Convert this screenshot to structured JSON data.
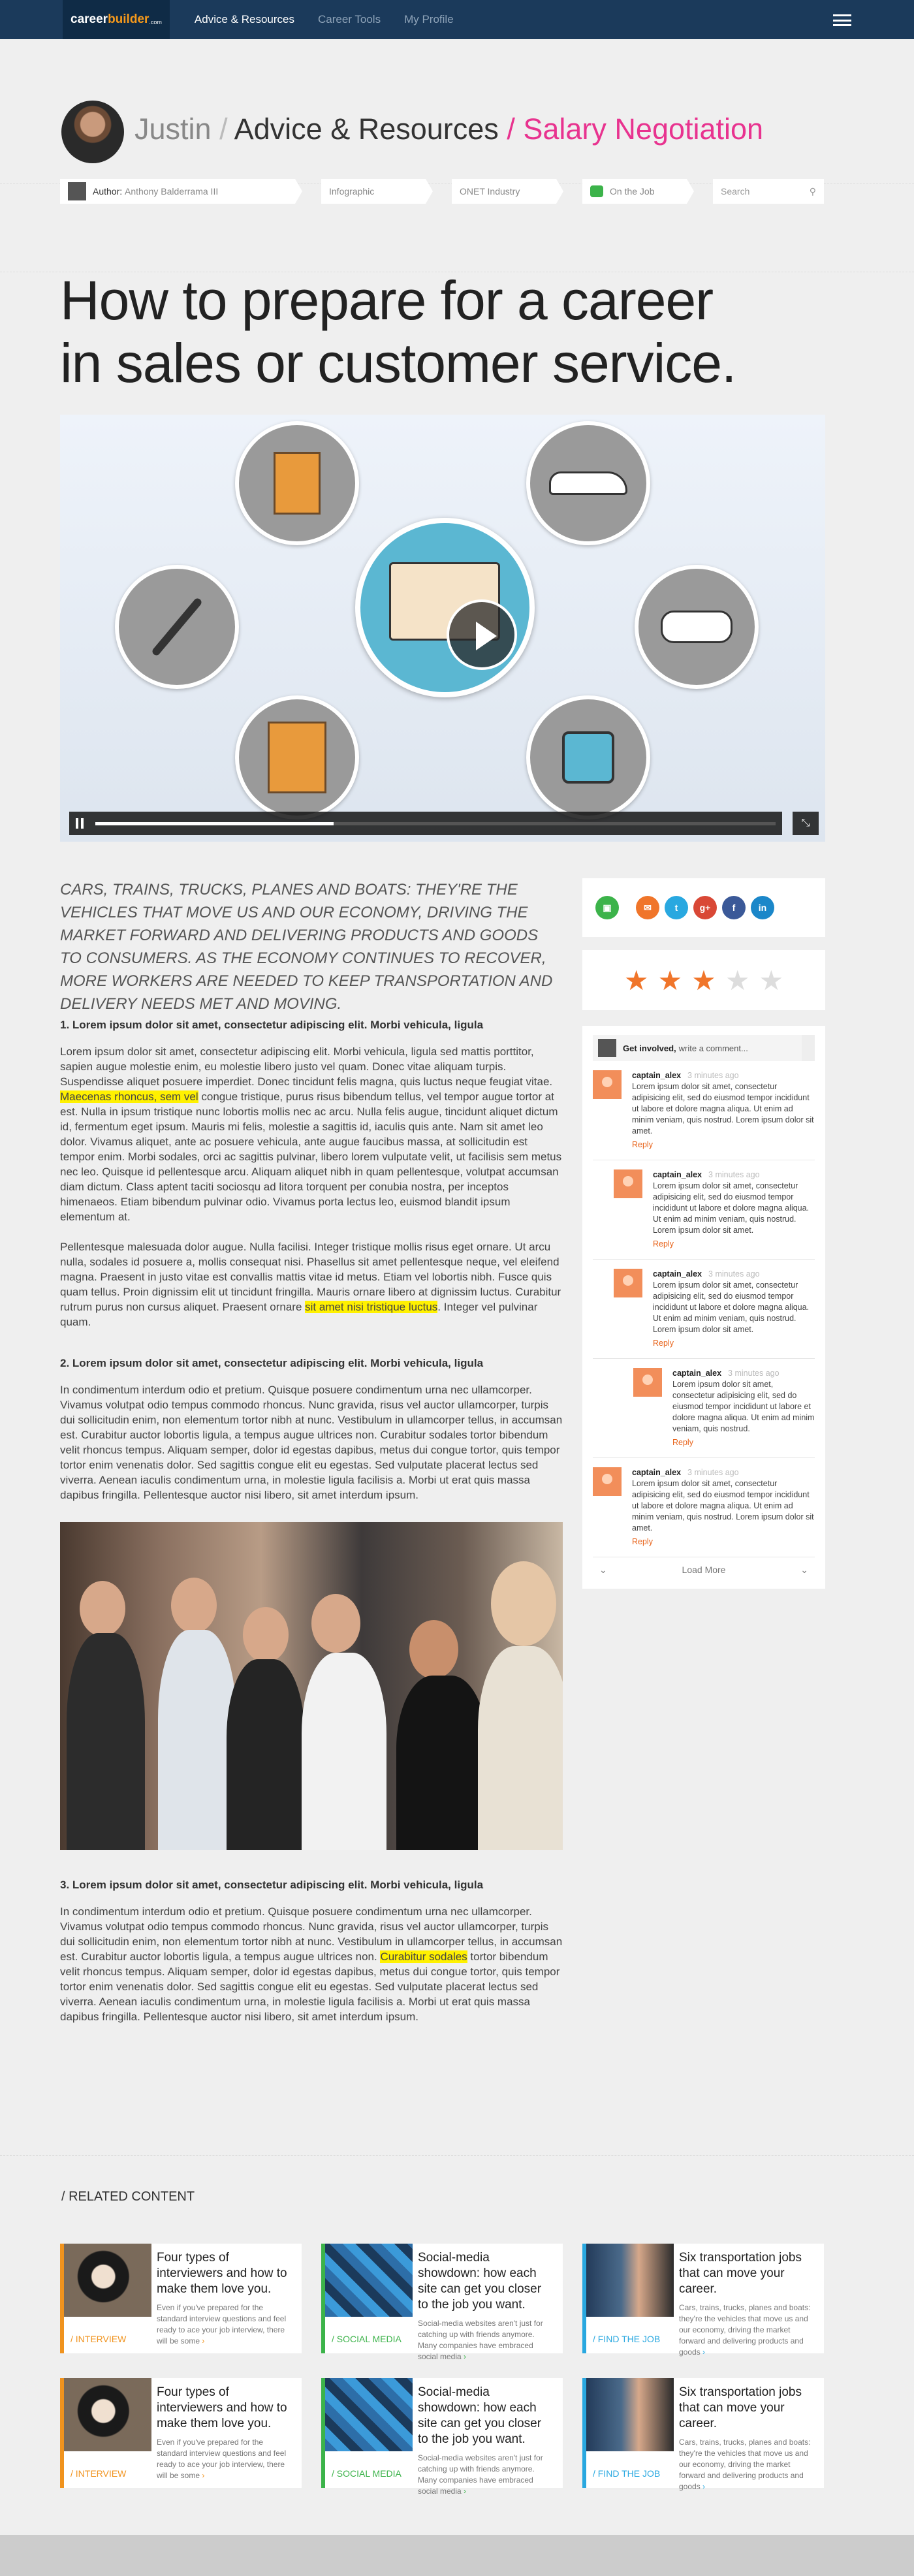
{
  "nav": {
    "logo_a": "career",
    "logo_b": "builder",
    "logo_c": ".com",
    "links": [
      "Advice & Resources",
      "Career Tools",
      "My Profile"
    ]
  },
  "breadcrumb": {
    "user": "Justin",
    "sep": "/",
    "section": "Advice & Resources",
    "topic": "Salary Negotiation"
  },
  "tags": {
    "author_label": "Author:",
    "author_name": "Anthony Balderrama III",
    "type": "Infographic",
    "industry": "ONET Industry",
    "location": "On the Job",
    "search_placeholder": "Search"
  },
  "article": {
    "title_line1": "How to prepare for a career",
    "title_line2": "in sales or customer service.",
    "intro": "Cars, trains, trucks, planes and boats: they're the vehicles that move us and our economy, driving the market forward and delivering products and goods to consumers. As the economy continues to recover, more workers are needed to keep transportation and delivery needs met and moving.",
    "s1_heading": "1. Lorem ipsum dolor sit amet, consectetur adipiscing elit. Morbi vehicula, ligula",
    "s1_p1_a": "Lorem ipsum dolor sit amet, consectetur adipiscing elit. Morbi vehicula, ligula sed mattis porttitor, sapien augue molestie enim, eu molestie libero justo vel quam. Donec vitae aliquam turpis. Suspendisse aliquet posuere imperdiet. Donec tincidunt felis magna, quis luctus neque feugiat vitae. ",
    "s1_p1_hl": "Maecenas rhoncus, sem vel",
    "s1_p1_b": " congue tristique, purus risus bibendum tellus, vel tempor augue tortor at est. Nulla in ipsum tristique nunc lobortis mollis nec ac arcu. Nulla felis augue, tincidunt aliquet dictum id, fermentum eget ipsum. Mauris mi felis, molestie a sagittis id, iaculis quis ante. Nam sit amet leo dolor. Vivamus aliquet, ante ac posuere vehicula, ante augue faucibus massa, at sollicitudin est tempor enim. Morbi sodales, orci ac sagittis pulvinar, libero lorem vulputate velit, ut facilisis sem metus nec leo. Quisque id pellentesque arcu. Aliquam aliquet nibh in quam pellentesque, volutpat accumsan diam dictum. Class aptent taciti sociosqu ad litora torquent per conubia nostra, per inceptos himenaeos. Etiam bibendum pulvinar odio. Vivamus porta lectus leo, euismod blandit ipsum elementum at.",
    "s1_p2_a": "Pellentesque malesuada dolor augue. Nulla facilisi. Integer tristique mollis risus eget ornare. Ut arcu nulla, sodales id posuere a, mollis consequat nisi. Phasellus sit amet pellentesque neque, vel eleifend magna. Praesent in justo vitae est convallis mattis vitae id metus. Etiam vel lobortis nibh. Fusce quis quam tellus. Proin dignissim elit ut tincidunt fringilla. Mauris ornare libero at dignissim luctus. Curabitur rutrum purus non cursus aliquet. Praesent ornare ",
    "s1_p2_hl": "sit amet nisi tristique luctus",
    "s1_p2_b": ". Integer vel pulvinar quam.",
    "s2_heading": "2. Lorem ipsum dolor sit amet, consectetur adipiscing elit. Morbi vehicula, ligula",
    "s2_p1": "In condimentum interdum odio et pretium. Quisque posuere condimentum urna nec ullamcorper. Vivamus volutpat odio tempus commodo rhoncus. Nunc gravida, risus vel auctor ullamcorper, turpis dui sollicitudin enim, non elementum tortor nibh at nunc. Vestibulum in ullamcorper tellus, in accumsan est. Curabitur auctor lobortis ligula, a tempus augue ultrices non. Curabitur sodales tortor bibendum velit rhoncus tempus. Aliquam semper, dolor id egestas dapibus, metus dui congue tortor, quis tempor tortor enim venenatis dolor. Sed sagittis congue elit eu egestas. Sed vulputate placerat lectus sed viverra. Aenean iaculis condimentum urna, in molestie ligula facilisis a. Morbi ut erat quis massa dapibus fringilla. Pellentesque auctor nisi libero, sit amet interdum ipsum.",
    "s3_heading": "3. Lorem ipsum dolor sit amet, consectetur adipiscing elit. Morbi vehicula, ligula",
    "s3_p1_a": "In condimentum interdum odio et pretium. Quisque posuere condimentum urna nec ullamcorper. Vivamus volutpat odio tempus commodo rhoncus. Nunc gravida, risus vel auctor ullamcorper, turpis dui sollicitudin enim, non elementum tortor nibh at nunc. Vestibulum in ullamcorper tellus, in accumsan est. Curabitur auctor lobortis ligula, a tempus augue ultrices non. ",
    "s3_p1_hl": "Curabitur sodales",
    "s3_p1_b": " tortor bibendum velit rhoncus tempus. Aliquam semper, dolor id egestas dapibus, metus dui congue tortor, quis tempor tortor enim venenatis dolor. Sed sagittis congue elit eu egestas. Sed vulputate placerat lectus sed viverra. Aenean iaculis condimentum urna, in molestie ligula facilisis a. Morbi ut erat quis massa dapibus fringilla. Pellentesque auctor nisi libero, sit amet interdum ipsum."
  },
  "video": {
    "progress": 0.35,
    "icons": [
      "building-icon",
      "car-icon",
      "pen-icon",
      "notebook-icon",
      "handshake-icon",
      "podium-icon",
      "watch-icon"
    ]
  },
  "share": {
    "icons": [
      {
        "name": "save-icon",
        "glyph": "▣",
        "color": "#3cb34a"
      },
      {
        "name": "email-icon",
        "glyph": "✉",
        "color": "#f0752a"
      },
      {
        "name": "twitter-icon",
        "glyph": "t",
        "color": "#29a8e0"
      },
      {
        "name": "googleplus-icon",
        "glyph": "g+",
        "color": "#d94836"
      },
      {
        "name": "facebook-icon",
        "glyph": "f",
        "color": "#3b5998"
      },
      {
        "name": "linkedin-icon",
        "glyph": "in",
        "color": "#1b87c9"
      }
    ]
  },
  "rating": {
    "value": 3,
    "max": 5,
    "on_color": "#f0752a",
    "off_color": "#dddddd"
  },
  "comments": {
    "prompt_bold": "Get involved,",
    "prompt_rest": "write a comment...",
    "items": [
      {
        "user": "captain_alex",
        "time": "3 minutes ago",
        "text": "Lorem ipsum dolor sit amet, consectetur adipisicing elit, sed do eiusmod tempor incididunt ut labore et dolore magna aliqua. Ut enim ad minim veniam, quis nostrud. Lorem ipsum dolor sit amet.",
        "reply": "Reply",
        "level": 0
      },
      {
        "user": "captain_alex",
        "time": "3 minutes ago",
        "text": "Lorem ipsum dolor sit amet, consectetur adipisicing elit, sed do eiusmod tempor incididunt ut labore et dolore magna aliqua. Ut enim ad minim veniam, quis nostrud. Lorem ipsum dolor sit amet.",
        "reply": "Reply",
        "level": 1
      },
      {
        "user": "captain_alex",
        "time": "3 minutes ago",
        "text": "Lorem ipsum dolor sit amet, consectetur adipisicing elit, sed do eiusmod tempor incididunt ut labore et dolore magna aliqua. Ut enim ad minim veniam, quis nostrud. Lorem ipsum dolor sit amet.",
        "reply": "Reply",
        "level": 1
      },
      {
        "user": "captain_alex",
        "time": "3 minutes ago",
        "text": "Lorem ipsum dolor sit amet, consectetur adipisicing elit, sed do eiusmod tempor incididunt ut labore et dolore magna aliqua. Ut enim ad minim veniam, quis nostrud.",
        "reply": "Reply",
        "level": 2
      },
      {
        "user": "captain_alex",
        "time": "3 minutes ago",
        "text": "Lorem ipsum dolor sit amet, consectetur adipisicing elit, sed do eiusmod tempor incididunt ut labore et dolore magna aliqua. Ut enim ad minim veniam, quis nostrud. Lorem ipsum dolor sit amet.",
        "reply": "Reply",
        "level": 0
      }
    ],
    "load_more": "Load More"
  },
  "related": {
    "title": "/ RELATED CONTENT",
    "cards": [
      {
        "cat": "/ INTERVIEW",
        "title": "Four types of interviewers and how to make them love you.",
        "desc": "Even if you've prepared for the standard interview questions and feel ready to ace your job interview, there will be some",
        "color": "#f0931e",
        "img": "interviewer"
      },
      {
        "cat": "/ SOCIAL MEDIA",
        "title": "Social-media showdown: how each site can get you closer to the job you want.",
        "desc": "Social-media websites aren't just for catching up with friends anymore. Many companies have embraced social media",
        "color": "#3cb34a",
        "img": "social"
      },
      {
        "cat": "/ FIND THE JOB",
        "title": "Six transportation jobs that can move your career.",
        "desc": "Cars, trains, trucks, planes and boats: they're the vehicles that move us and our economy, driving the market forward and delivering products and goods",
        "color": "#29a8e0",
        "img": "jobs"
      },
      {
        "cat": "/ INTERVIEW",
        "title": "Four types of interviewers and how to make them love you.",
        "desc": "Even if you've prepared for the standard interview questions and feel ready to ace your job interview, there will be some",
        "color": "#f0931e",
        "img": "interviewer"
      },
      {
        "cat": "/ SOCIAL MEDIA",
        "title": "Social-media showdown: how each site can get you closer to the job you want.",
        "desc": "Social-media websites aren't just for catching up with friends anymore. Many companies have embraced social media",
        "color": "#3cb34a",
        "img": "social"
      },
      {
        "cat": "/ FIND THE JOB",
        "title": "Six transportation jobs that can move your career.",
        "desc": "Cars, trains, trucks, planes and boats: they're the vehicles that move us and our economy, driving the market forward and delivering products and goods",
        "color": "#29a8e0",
        "img": "jobs"
      }
    ]
  }
}
